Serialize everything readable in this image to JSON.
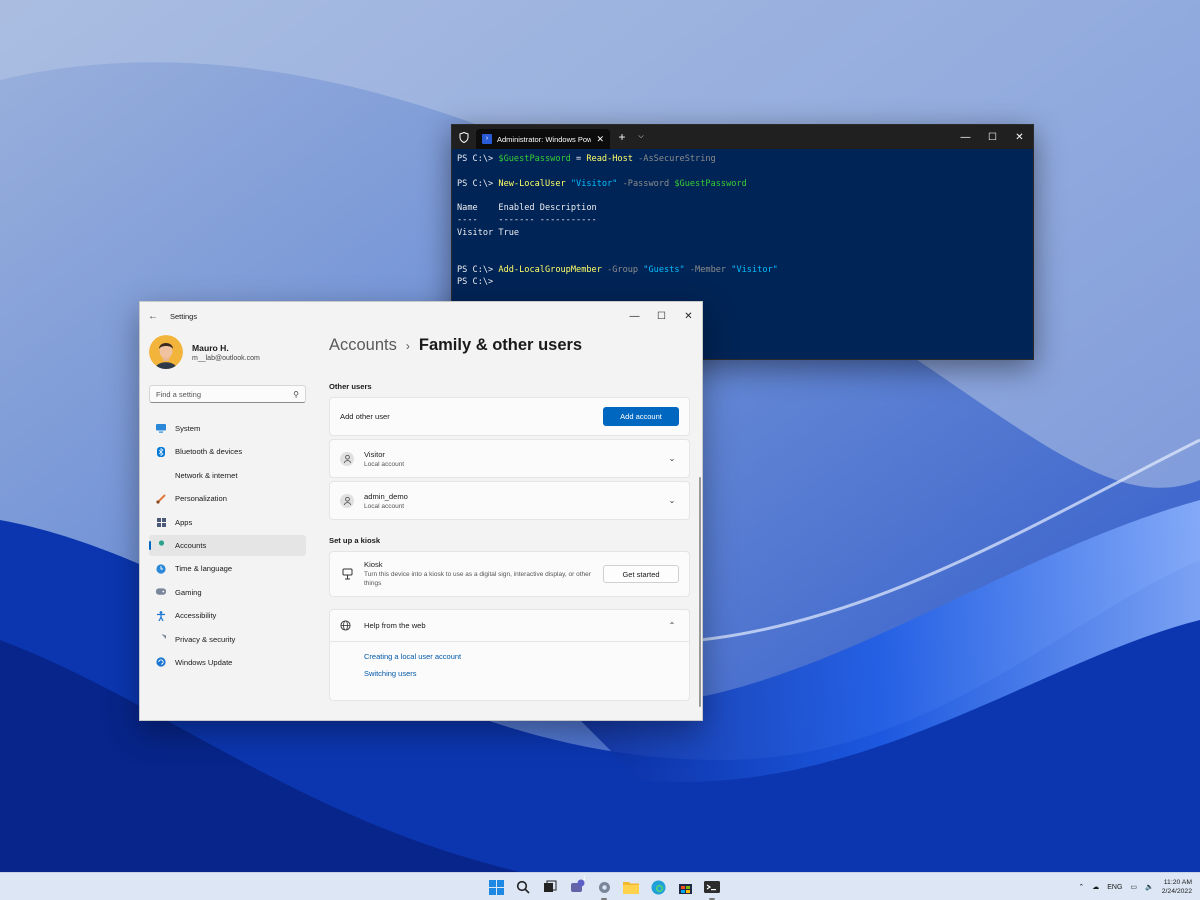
{
  "terminal": {
    "tab_title": "Administrator: Windows Powe",
    "tab_close": "✕",
    "new_tab": "+",
    "dropdown": "⌵",
    "ctl_min": "—",
    "ctl_max": "☐",
    "ctl_close": "✕",
    "lines": [
      {
        "parts": [
          [
            "PS C:\\> ",
            ""
          ],
          [
            "$GuestPassword",
            "var"
          ],
          [
            " = ",
            ""
          ],
          [
            "Read-Host",
            "cmd"
          ],
          [
            " -AsSecureString",
            "param"
          ]
        ]
      },
      {
        "parts": [
          [
            "",
            ""
          ]
        ]
      },
      {
        "parts": [
          [
            "PS C:\\> ",
            ""
          ],
          [
            "New-LocalUser",
            "cmd"
          ],
          [
            " \"Visitor\"",
            "str"
          ],
          [
            " -Password ",
            "param"
          ],
          [
            "$GuestPassword",
            "var"
          ]
        ]
      },
      {
        "parts": [
          [
            "",
            ""
          ]
        ]
      },
      {
        "parts": [
          [
            "Name    Enabled Description",
            ""
          ]
        ]
      },
      {
        "parts": [
          [
            "----    ------- -----------",
            ""
          ]
        ]
      },
      {
        "parts": [
          [
            "Visitor True",
            ""
          ]
        ]
      },
      {
        "parts": [
          [
            "",
            ""
          ]
        ]
      },
      {
        "parts": [
          [
            "",
            ""
          ]
        ]
      },
      {
        "parts": [
          [
            "PS C:\\> ",
            ""
          ],
          [
            "Add-LocalGroupMember",
            "cmd"
          ],
          [
            " -Group ",
            "param"
          ],
          [
            "\"Guests\"",
            "str"
          ],
          [
            " -Member ",
            "param"
          ],
          [
            "\"Visitor\"",
            "str"
          ]
        ]
      },
      {
        "parts": [
          [
            "PS C:\\>",
            ""
          ]
        ]
      }
    ]
  },
  "settings": {
    "window_title": "Settings",
    "back": "←",
    "ctl_min": "—",
    "ctl_max": "☐",
    "ctl_close": "✕",
    "profile": {
      "name": "Mauro H.",
      "email": "m__lab@outlook.com"
    },
    "search": {
      "placeholder": "Find a setting"
    },
    "nav": [
      {
        "label": "System",
        "icon": "system-icon",
        "color": "#2b88d8"
      },
      {
        "label": "Bluetooth & devices",
        "icon": "bluetooth-icon",
        "color": "#0078d4"
      },
      {
        "label": "Network & internet",
        "icon": "wifi-icon",
        "color": "#3a7bd5"
      },
      {
        "label": "Personalization",
        "icon": "brush-icon",
        "color": "#e0793b"
      },
      {
        "label": "Apps",
        "icon": "apps-icon",
        "color": "#4a5a78"
      },
      {
        "label": "Accounts",
        "icon": "accounts-icon",
        "color": "#2aa38a",
        "active": true
      },
      {
        "label": "Time & language",
        "icon": "globe-clock-icon",
        "color": "#2b88d8"
      },
      {
        "label": "Gaming",
        "icon": "gamepad-icon",
        "color": "#7a8699"
      },
      {
        "label": "Accessibility",
        "icon": "accessibility-icon",
        "color": "#1b76d1"
      },
      {
        "label": "Privacy & security",
        "icon": "shield-icon",
        "color": "#7a8699"
      },
      {
        "label": "Windows Update",
        "icon": "update-icon",
        "color": "#1b76d1"
      }
    ],
    "breadcrumb": {
      "parent": "Accounts",
      "separator": "›",
      "current": "Family & other users"
    },
    "other_users": {
      "heading": "Other users",
      "add_label": "Add other user",
      "add_button": "Add account",
      "users": [
        {
          "name": "Visitor",
          "type": "Local account"
        },
        {
          "name": "admin_demo",
          "type": "Local account"
        }
      ]
    },
    "kiosk": {
      "heading": "Set up a kiosk",
      "title": "Kiosk",
      "description": "Turn this device into a kiosk to use as a digital sign, interactive display, or other things",
      "button": "Get started"
    },
    "help": {
      "title": "Help from the web",
      "links": [
        "Creating a local user account",
        "Switching users"
      ]
    },
    "accent_color": "#0067c0"
  },
  "taskbar": {
    "tray": {
      "language": "ENG",
      "time": "11:20 AM",
      "date": "2/24/2022"
    },
    "chat_badge": "1"
  }
}
